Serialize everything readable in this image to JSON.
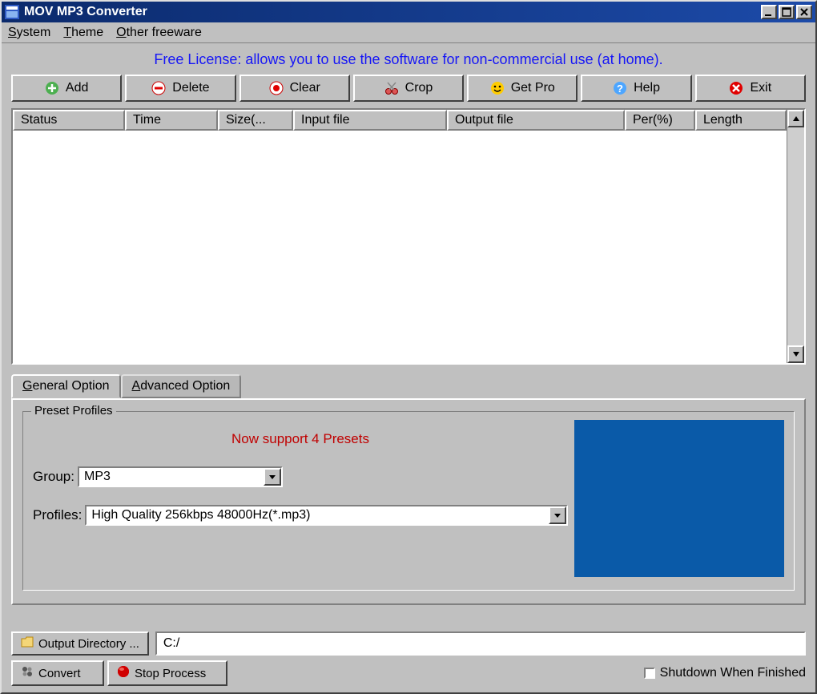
{
  "window": {
    "title": "MOV MP3 Converter"
  },
  "menu": {
    "system": "System",
    "theme": "Theme",
    "other": "Other freeware"
  },
  "license": "Free License: allows you to use the software for non-commercial use (at home).",
  "toolbar": {
    "add": "Add",
    "delete": "Delete",
    "clear": "Clear",
    "crop": "Crop",
    "getpro": "Get Pro",
    "help": "Help",
    "exit": "Exit"
  },
  "columns": {
    "status": "Status",
    "time": "Time",
    "size": "Size(...",
    "input": "Input file",
    "output": "Output file",
    "per": "Per(%)",
    "length": "Length"
  },
  "tabs": {
    "general": "General Option",
    "advanced": "Advanced Option"
  },
  "preset": {
    "legend": "Preset Profiles",
    "message": "Now support 4 Presets",
    "group_label": "Group:",
    "group_value": "MP3",
    "profiles_label": "Profiles:",
    "profiles_value": "High Quality 256kbps 48000Hz(*.mp3)"
  },
  "output": {
    "button": "Output Directory ...",
    "path": "C:/"
  },
  "actions": {
    "convert": "Convert",
    "stop": "Stop Process",
    "shutdown": "Shutdown When Finished"
  }
}
